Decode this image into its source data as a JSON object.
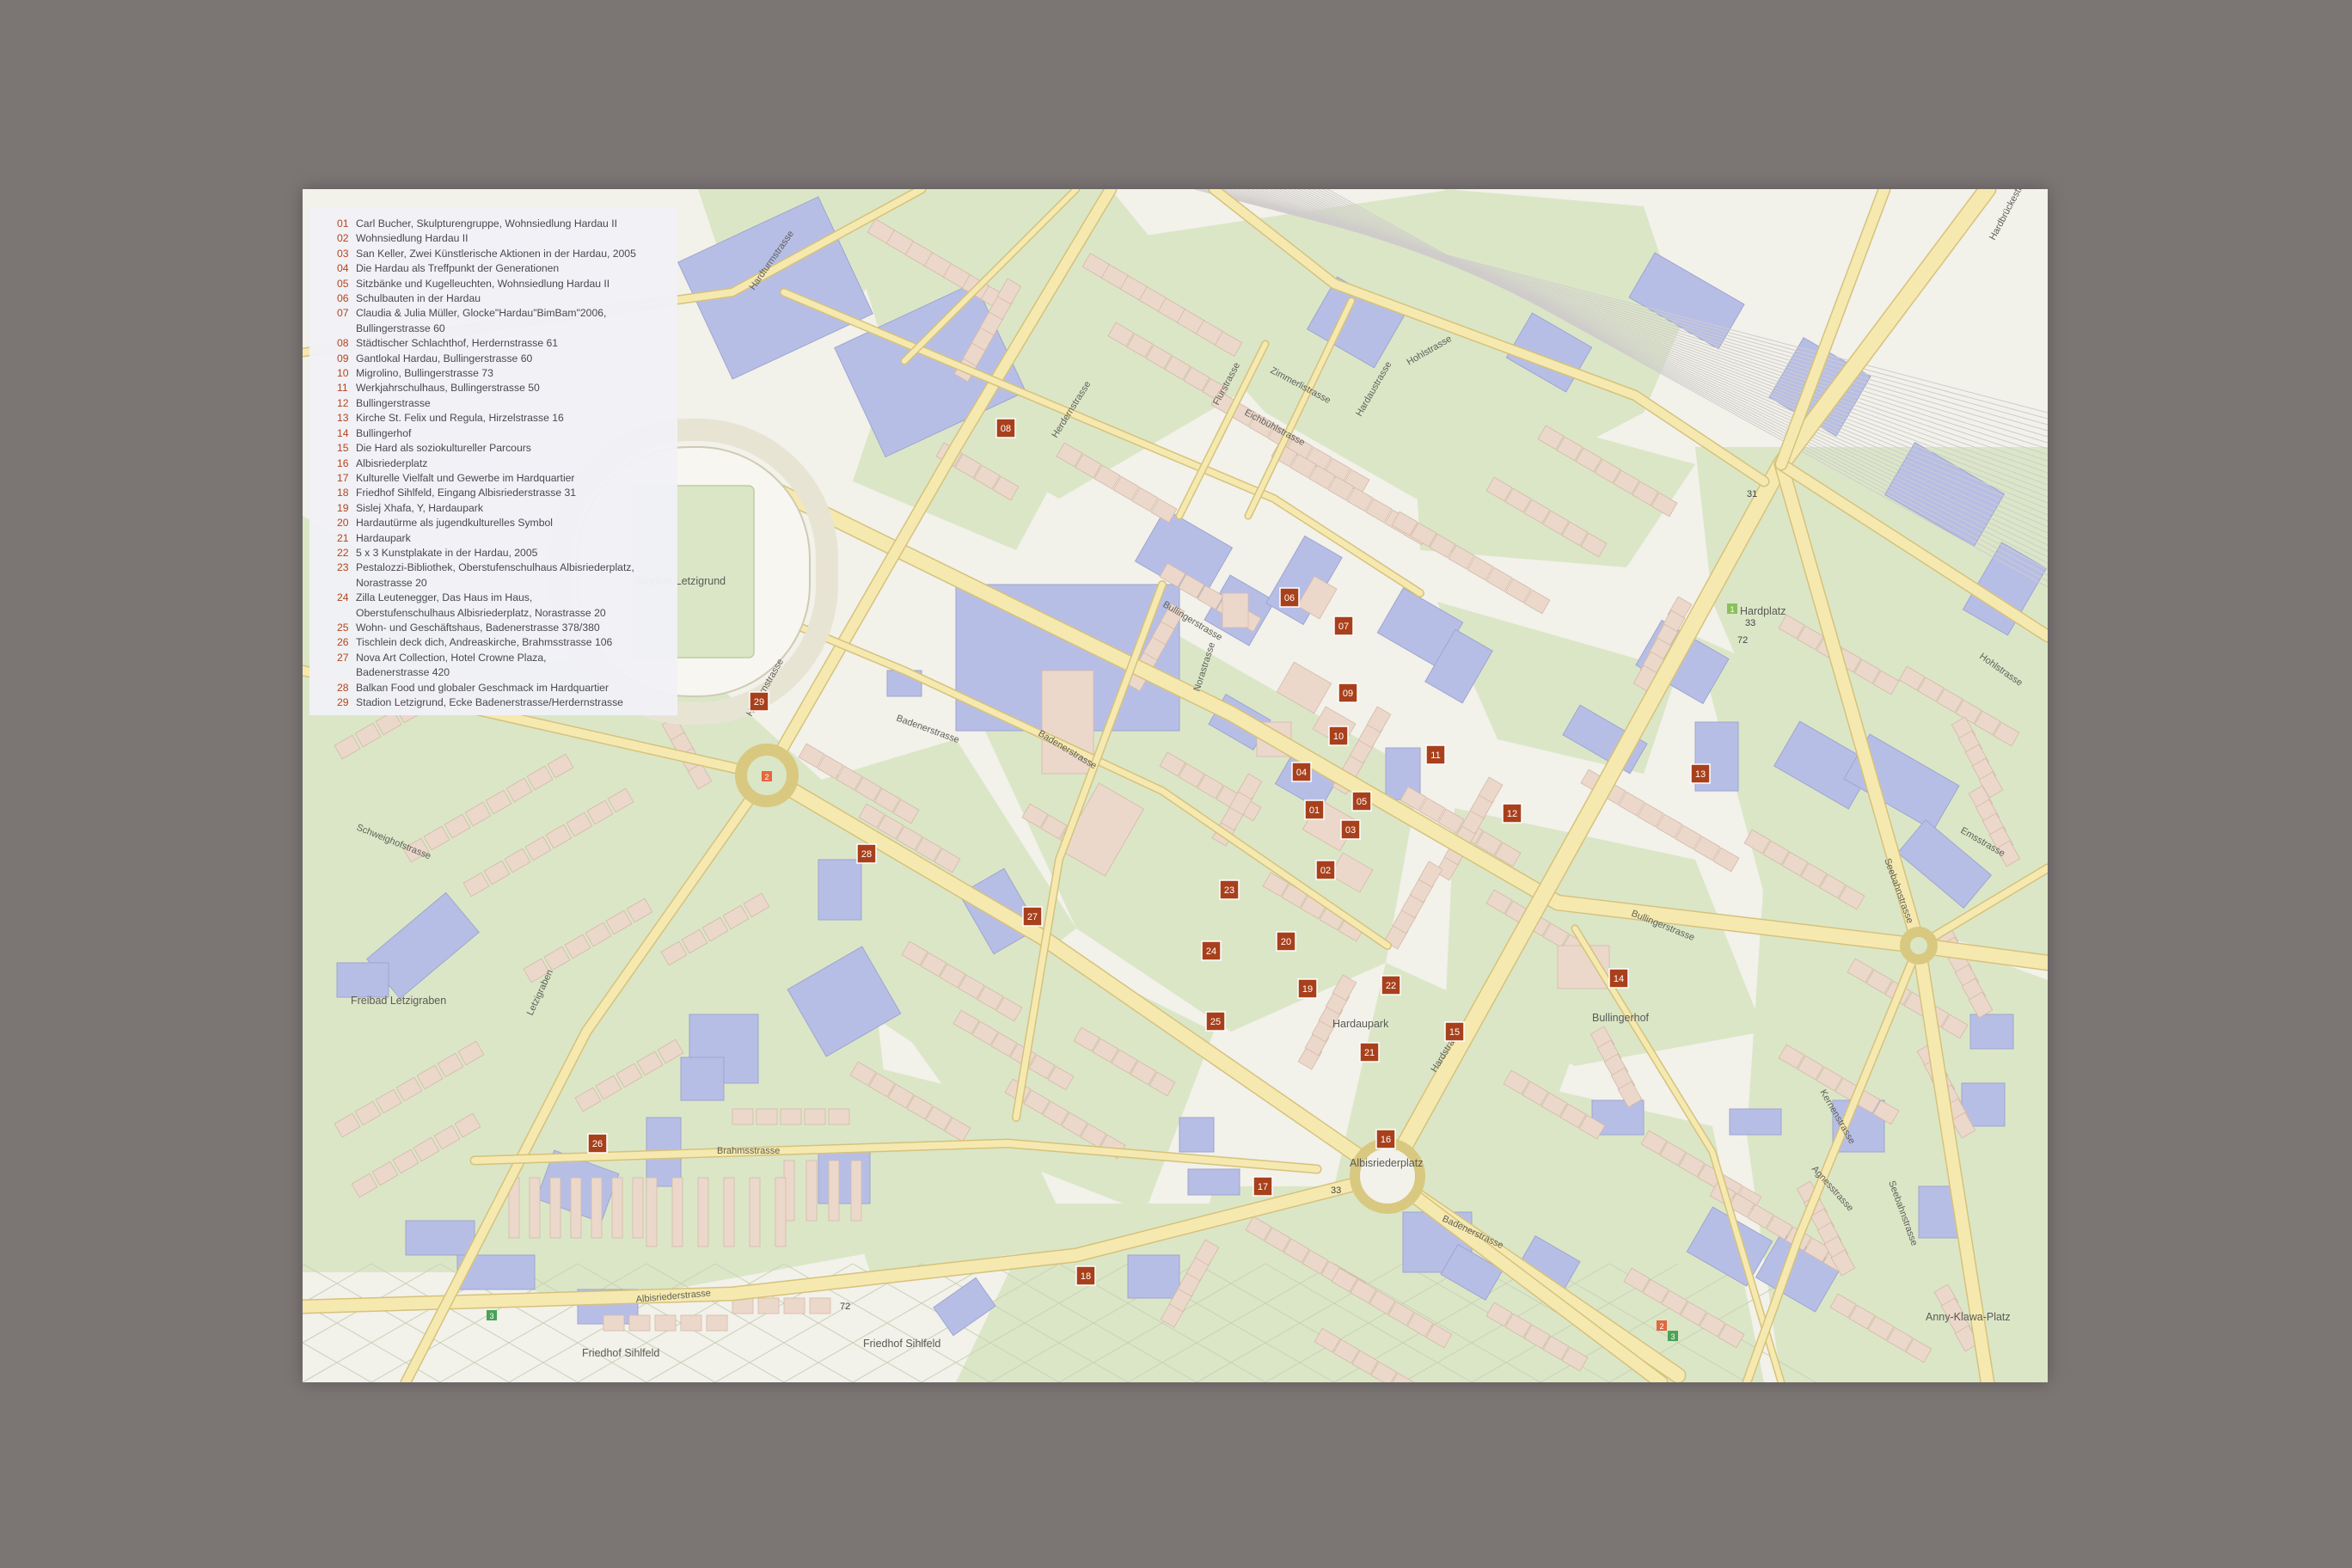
{
  "legend": {
    "entries": [
      {
        "num": "01",
        "text": "Carl Bucher, Skulpturengruppe, Wohnsiedlung Hardau II"
      },
      {
        "num": "02",
        "text": "Wohnsiedlung Hardau II"
      },
      {
        "num": "03",
        "text": "San Keller, Zwei Künstlerische Aktionen in der Hardau, 2005"
      },
      {
        "num": "04",
        "text": "Die Hardau als Treffpunkt der Generationen"
      },
      {
        "num": "05",
        "text": "Sitzbänke und Kugelleuchten, Wohnsiedlung Hardau II"
      },
      {
        "num": "06",
        "text": "Schulbauten in der Hardau"
      },
      {
        "num": "07",
        "text": "Claudia & Julia Müller, Glocke\"Hardau\"BimBam\"2006,\nBullingerstrasse 60"
      },
      {
        "num": "08",
        "text": "Städtischer Schlachthof, Herdernstrasse 61"
      },
      {
        "num": "09",
        "text": "Gantlokal Hardau, Bullingerstrasse 60"
      },
      {
        "num": "10",
        "text": "Migrolino, Bullingerstrasse 73"
      },
      {
        "num": "11",
        "text": "Werkjahrschulhaus, Bullingerstrasse 50"
      },
      {
        "num": "12",
        "text": "Bullingerstrasse"
      },
      {
        "num": "13",
        "text": "Kirche St. Felix und Regula, Hirzelstrasse 16"
      },
      {
        "num": "14",
        "text": "Bullingerhof"
      },
      {
        "num": "15",
        "text": "Die Hard als soziokultureller Parcours"
      },
      {
        "num": "16",
        "text": "Albisriederplatz"
      },
      {
        "num": "17",
        "text": "Kulturelle Vielfalt und Gewerbe im Hardquartier"
      },
      {
        "num": "18",
        "text": "Friedhof Sihlfeld, Eingang Albisriederstrasse 31"
      },
      {
        "num": "19",
        "text": "Sislej Xhafa, Y, Hardaupark"
      },
      {
        "num": "20",
        "text": "Hardautürme als jugendkulturelles Symbol"
      },
      {
        "num": "21",
        "text": "Hardaupark"
      },
      {
        "num": "22",
        "text": "5 x 3 Kunstplakate in der Hardau, 2005"
      },
      {
        "num": "23",
        "text": "Pestalozzi-Bibliothek, Oberstufenschulhaus Albisriederplatz,\nNorastrasse 20"
      },
      {
        "num": "24",
        "text": "Zilla Leutenegger, Das Haus im Haus,\nOberstufenschulhaus Albisriederplatz, Norastrasse 20"
      },
      {
        "num": "25",
        "text": "Wohn- und Geschäftshaus, Badenerstrasse 378/380"
      },
      {
        "num": "26",
        "text": "Tischlein deck dich, Andreaskirche, Brahmsstrasse 106"
      },
      {
        "num": "27",
        "text": "Nova Art Collection, Hotel Crowne Plaza,\nBadenerstrasse 420"
      },
      {
        "num": "28",
        "text": "Balkan Food und globaler Geschmack im Hardquartier"
      },
      {
        "num": "29",
        "text": "Stadion Letzigrund, Ecke Badenerstrasse/Herdernstrasse"
      }
    ]
  },
  "markers": [
    "01",
    "02",
    "03",
    "04",
    "05",
    "06",
    "07",
    "08",
    "09",
    "10",
    "11",
    "12",
    "13",
    "14",
    "15",
    "16",
    "17",
    "18",
    "19",
    "20",
    "21",
    "22",
    "23",
    "24",
    "25",
    "26",
    "27",
    "28",
    "29"
  ],
  "places": {
    "stadion": "Stadion Letzigrund",
    "hardplatz": "Hardplatz",
    "hardaupark": "Hardaupark",
    "bullingerhof": "Bullingerhof",
    "freibad": "Freibad Letzigraben",
    "albisriederplatz": "Albisriederplatz",
    "friedhof_1": "Friedhof Sihlfeld",
    "friedhof_2": "Friedhof Sihlfeld",
    "anny_klawa": "Anny-Klawa-Platz"
  },
  "streets": {
    "bullinger_1": "Bullingerstrasse",
    "bullinger_2": "Bullingerstrasse",
    "badener_1": "Badenerstrasse",
    "badener_2": "Badenerstrasse",
    "badener_3": "Badenerstrasse",
    "herdern_1": "Herdernstrasse",
    "herdern_2": "Herdernstrasse",
    "hohl_1": "Hohlstrasse",
    "hohl_2": "Hohlstrasse",
    "eichbuehl": "Eichbühlstrasse",
    "zimmerli": "Zimmerlistrasse",
    "hardau": "Hardaustrasse",
    "hard": "Hardstrasse",
    "brahms": "Brahmsstrasse",
    "albisrieder": "Albisriederstrasse",
    "letzigraben": "Letzigraben",
    "seebahn_1": "Seebahnstrasse",
    "seebahn_2": "Seebahnstrasse",
    "ems": "Emsstrasse",
    "hardbruecke": "Hardbrückestrasse",
    "nora": "Norastrasse",
    "flur": "Flurstrasse",
    "agnes": "Agnesstrasse",
    "kernen": "Kernenstrasse",
    "hardturm": "Hardturmstrasse",
    "schweighof": "Schweighofstrasse"
  },
  "road_numbers": [
    "31",
    "33",
    "72",
    "33",
    "72"
  ],
  "transit_labels": [
    "2",
    "2",
    "3",
    "3",
    "1"
  ],
  "colors": {
    "background": "#7b7574",
    "paper": "#f2f1ea",
    "green": "#dbe6c7",
    "road": "#f6e9b0",
    "road_edge": "#d5c27c",
    "residential": "#ecd8cb",
    "public": "#b7bee6",
    "marker": "#a8401c"
  }
}
